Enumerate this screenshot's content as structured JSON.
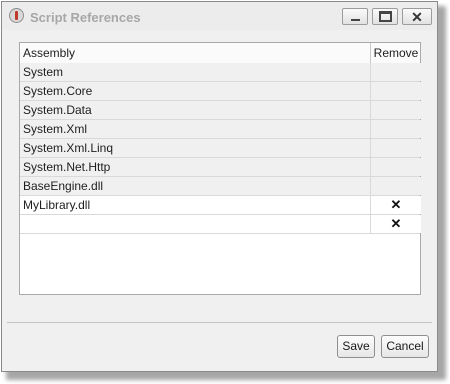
{
  "window": {
    "title": "Script References"
  },
  "table": {
    "col_assembly": "Assembly",
    "col_remove": "Remove",
    "rows": [
      {
        "name": "System",
        "remove": ""
      },
      {
        "name": "System.Core",
        "remove": ""
      },
      {
        "name": "System.Data",
        "remove": ""
      },
      {
        "name": "System.Xml",
        "remove": ""
      },
      {
        "name": "System.Xml.Linq",
        "remove": ""
      },
      {
        "name": "System.Net.Http",
        "remove": ""
      },
      {
        "name": "BaseEngine.dll",
        "remove": ""
      },
      {
        "name": "MyLibrary.dll",
        "remove": "✕"
      },
      {
        "name": "",
        "remove": "✕"
      }
    ]
  },
  "buttons": {
    "save": "Save",
    "cancel": "Cancel"
  }
}
